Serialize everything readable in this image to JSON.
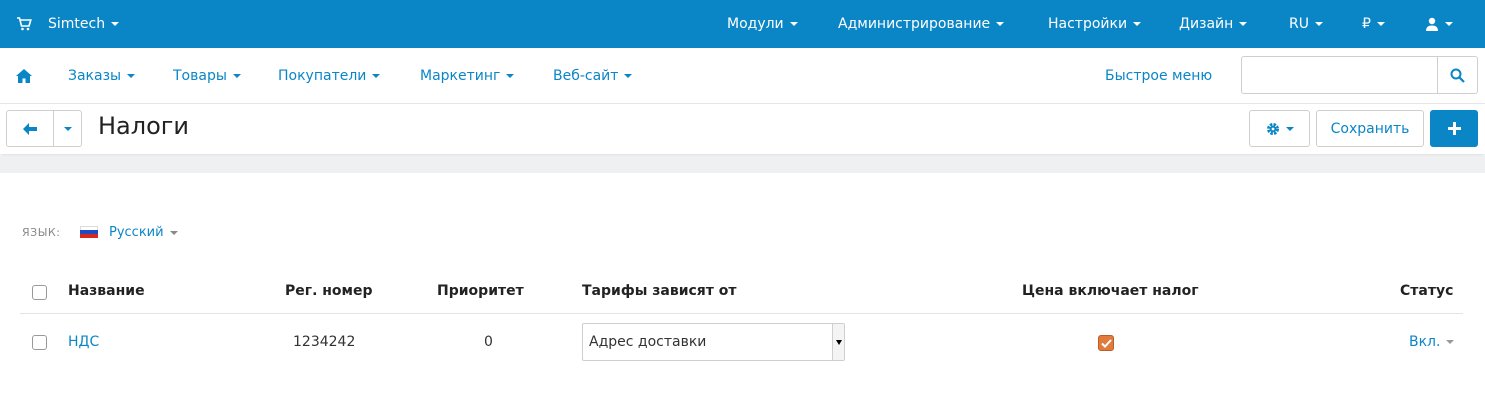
{
  "topbar": {
    "brand": "Simtech",
    "menu": [
      "Модули",
      "Администрирование",
      "Настройки",
      "Дизайн",
      "RU",
      "₽"
    ],
    "color": "#0a86c7"
  },
  "mainnav": {
    "items": [
      "Заказы",
      "Товары",
      "Покупатели",
      "Маркетинг",
      "Веб-сайт"
    ],
    "quick_menu": "Быстрое меню",
    "search_placeholder": ""
  },
  "toolbar": {
    "title": "Налоги",
    "save_label": "Сохранить"
  },
  "language": {
    "label": "ЯЗЫК:",
    "value": "Русский"
  },
  "table": {
    "headers": [
      "Название",
      "Рег. номер",
      "Приоритет",
      "Тарифы зависят от",
      "Цена включает налог",
      "Статус"
    ],
    "rows": [
      {
        "name": "НДС",
        "reg_number": "1234242",
        "priority": "0",
        "rates_depend_on": "Адрес доставки",
        "price_includes_tax": true,
        "status": "Вкл."
      }
    ]
  },
  "colors": {
    "link": "#0a86c7",
    "checkbox_checked": "#e07b3c"
  }
}
